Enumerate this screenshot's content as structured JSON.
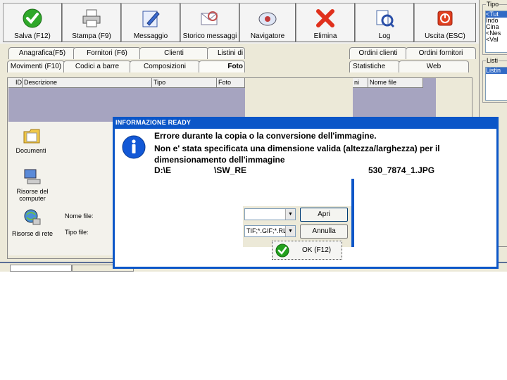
{
  "toolbar": {
    "buttons": [
      {
        "label": "Salva (F12)",
        "icon": "check-icon"
      },
      {
        "label": "Stampa (F9)",
        "icon": "printer-icon"
      },
      {
        "label": "Messaggio",
        "icon": "message-icon"
      },
      {
        "label": "Storico messaggi",
        "icon": "message-history-icon"
      },
      {
        "label": "Navigatore",
        "icon": "navigator-icon"
      },
      {
        "label": "Elimina",
        "icon": "delete-icon"
      },
      {
        "label": "Log",
        "icon": "log-icon"
      },
      {
        "label": "Uscita (ESC)",
        "icon": "exit-icon"
      }
    ]
  },
  "right_panel": {
    "tipo_title": "Tipo",
    "tipo_items": [
      "<Tut",
      "Indo",
      "Cina",
      "<Nes",
      "<Val"
    ],
    "listino_title": "Listi",
    "listino_items": [
      "Listin"
    ]
  },
  "tabs": {
    "row1": [
      "Anagrafica(F5)",
      "Fornitori (F6)",
      "Clienti",
      "Listini di v",
      "Ordini clienti",
      "Ordini fornitori"
    ],
    "row2": [
      "Movimenti (F10)",
      "Codici a barre",
      "Composizioni",
      "Foto",
      "Statistiche",
      "Web"
    ],
    "active": "Foto"
  },
  "grid": {
    "columns": [
      "ID",
      "Descrizione",
      "Tipo",
      "Foto"
    ],
    "columns_right": [
      "ni",
      "Nome file"
    ]
  },
  "file_dialog": {
    "places": [
      "Documenti",
      "Risorse del computer",
      "Risorse di rete"
    ],
    "filename_label": "Nome file:",
    "filetype_label": "Tipo file:",
    "filetype_value": "TIF;*.GIF;*.RL",
    "open_button": "Apri",
    "cancel_button": "Annulla"
  },
  "message_box": {
    "title": "INFORMAZIONE READY",
    "line1": "Errore durante la copia o la conversione dell'immagine.",
    "line2": "Non e' stata specificata una dimensione valida (altezza/larghezza) per il",
    "line3": "dimensionamento dell'immagine",
    "path_left": "D:\\E",
    "path_mid": "\\SW_RE",
    "path_right": "530_7874_1.JPG",
    "ok_label": "OK (F12)"
  },
  "colors": {
    "title_bar": "#0b56c8",
    "grid_background": "#a6a4c0",
    "info_icon": "#1258d6",
    "ok_icon": "#23a11e"
  }
}
